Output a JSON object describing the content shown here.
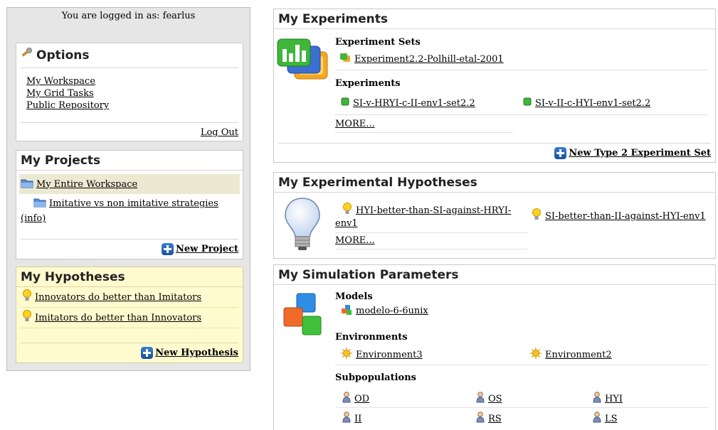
{
  "left": {
    "login_text": "You are logged in as: fearlus",
    "options": {
      "title": "Options",
      "links": [
        "My Workspace",
        "My Grid Tasks",
        "Public Repository"
      ],
      "logout": "Log Out"
    },
    "projects": {
      "title": "My Projects",
      "workspace": "My Entire Workspace",
      "project": "Imitative vs non imitative strategies",
      "info": "(info)",
      "new_label": "New Project"
    },
    "hypotheses": {
      "title": "My Hypotheses",
      "items": [
        "Innovators do better than Imitators",
        "Imitators do better than Innovators"
      ],
      "new_label": "New Hypothesis"
    }
  },
  "experiments": {
    "title": "My Experiments",
    "sets_title": "Experiment Sets",
    "sets": [
      "Experiment2.2-Polhill-etal-2001"
    ],
    "exp_title": "Experiments",
    "items": [
      "SI-v-HRYI-c-II-env1-set2.2",
      "SI-v-II-c-HYI-env1-set2.2"
    ],
    "more": "MORE...",
    "new_label": "New Type 2 Experiment Set"
  },
  "exp_hypotheses": {
    "title": "My Experimental Hypotheses",
    "item1_line1": "HYI-better-than-SI-against-HRYI-",
    "item1_line2": "env1",
    "item2": "SI-better-than-II-against-HYI-env1",
    "more": "MORE..."
  },
  "params": {
    "title": "My Simulation Parameters",
    "models_title": "Models",
    "models": [
      "modelo-6-6unix"
    ],
    "env_title": "Environments",
    "envs": [
      "Environment3",
      "Environment2"
    ],
    "subpop_title": "Subpopulations",
    "subpops": [
      "OD",
      "OS",
      "HYI",
      "II",
      "RS",
      "LS"
    ]
  }
}
